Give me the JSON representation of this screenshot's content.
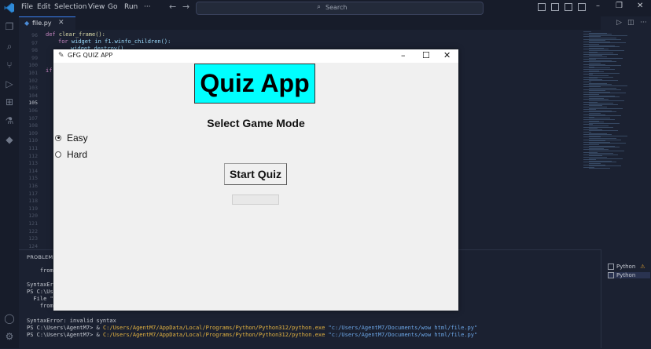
{
  "vscode": {
    "menu": [
      "File",
      "Edit",
      "Selection",
      "View",
      "Go",
      "Run",
      "···"
    ],
    "search_placeholder": "Search",
    "tab": {
      "name": "file.py"
    },
    "line_numbers": [
      "96",
      "97",
      "98",
      "99",
      "100",
      "101",
      "102",
      "103",
      "104",
      "105",
      "106",
      "107",
      "108",
      "109",
      "110",
      "111",
      "112",
      "113",
      "114",
      "115",
      "116",
      "117",
      "118",
      "119",
      "120",
      "121",
      "122",
      "123",
      "124"
    ],
    "code": {
      "line1_kw": "def ",
      "line1_fn": "clear_frame():",
      "line2_kw": "for ",
      "line2_rest": "widget in f1.winfo_children():",
      "line3": "widget.destroy()",
      "line4": "if"
    },
    "panel": {
      "tab_label": "PROBLEMS",
      "terminal_lines": {
        "l1": "    from",
        "l2": "SyntaxErro",
        "l3": "PS C:\\User",
        "l4": "  File \"c",
        "l5": "    from",
        "l6": "SyntaxError: invalid syntax",
        "l7_prompt": "PS C:\\Users\\AgentM7> & ",
        "l7_path": "C:/Users/AgentM7/AppData/Local/Programs/Python/Python312/python.exe",
        "l7_arg": " \"c:/Users/AgentM7/Documents/wow html/file.py\"",
        "l8_prompt": "PS C:\\Users\\AgentM7> & ",
        "l8_path": "C:/Users/AgentM7/AppData/Local/Programs/Python/Python312/python.exe",
        "l8_arg": " \"c:/Users/AgentM7/Documents/wow html/file.py\""
      },
      "side_items": [
        "Python",
        "Python"
      ]
    }
  },
  "tk_app": {
    "window_title": "GFG QUIZ APP",
    "heading": "Quiz App",
    "mode_label": "Select Game Mode",
    "options": [
      "Easy",
      "Hard"
    ],
    "selected_option": "Easy",
    "start_button": "Start Quiz",
    "heading_bg": "#00ffff"
  }
}
